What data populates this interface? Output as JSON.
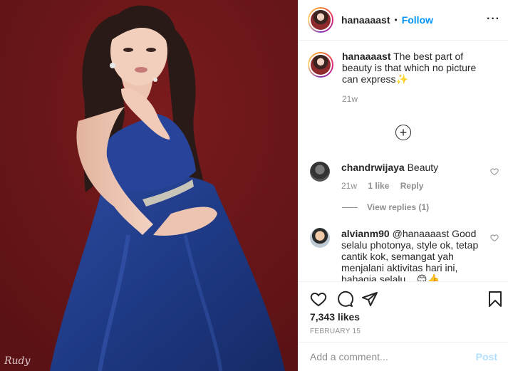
{
  "post": {
    "username": "hanaaaast",
    "separator": "•",
    "follow_label": "Follow",
    "more_label": "···",
    "caption_user": "hanaaaast",
    "caption_text": "The best part of beauty is that which no picture can express",
    "caption_emoji": "✨",
    "caption_age": "21w",
    "load_more_label": "+",
    "likes": "7,343 likes",
    "date": "FEBRUARY 15",
    "signature": "Rudy"
  },
  "comments": [
    {
      "user": "chandrwijaya",
      "text": "Beauty",
      "age": "21w",
      "likes": "1 like",
      "reply_label": "Reply",
      "view_replies": "View replies (1)"
    },
    {
      "user": "alvianm90",
      "text": "@hanaaaast Good selalu photonya, style ok, tetap cantik kok, semangat yah menjalani aktivitas hari ini, bahagia selalu... 😊👍"
    }
  ],
  "add_comment": {
    "placeholder": "Add a comment...",
    "post_label": "Post"
  },
  "icons": {
    "like": "heart-icon",
    "comment": "comment-bubble-icon",
    "share": "paper-plane-icon",
    "save": "bookmark-icon",
    "more": "ellipsis-icon"
  },
  "colors": {
    "background_photo": "#6e1719",
    "dress": "#233f8a",
    "link": "#0095f6",
    "post_disabled": "#b2dffc",
    "muted": "#8e8e8e"
  }
}
